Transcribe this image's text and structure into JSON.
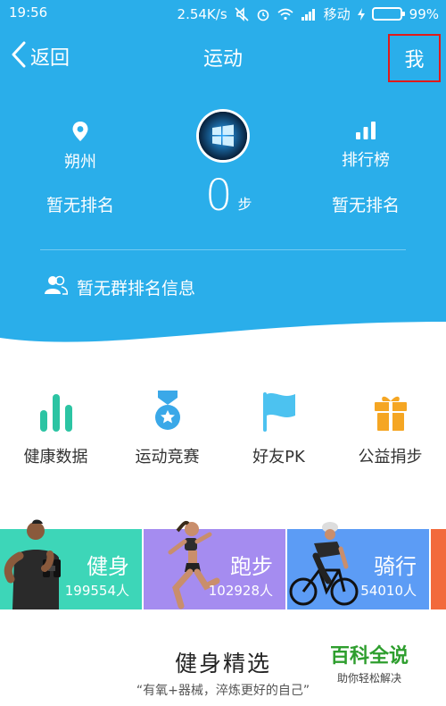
{
  "status_bar": {
    "time": "19:56",
    "network_speed": "2.54K/s",
    "carrier": "移动",
    "battery": "99%",
    "battery_level": 0.99
  },
  "nav": {
    "back_label": "返回",
    "title": "运动",
    "me_label": "我"
  },
  "profile": {
    "location": "朔州",
    "rank_board_label": "排行榜",
    "rank_left": "暂无排名",
    "rank_right": "暂无排名",
    "steps": "0",
    "steps_unit": "步",
    "group_info": "暂无群排名信息"
  },
  "features": [
    {
      "label": "健康数据",
      "icon": "bar-chart-icon",
      "color": "#2cc4a3"
    },
    {
      "label": "运动竞赛",
      "icon": "medal-icon",
      "color": "#3aa8e8"
    },
    {
      "label": "好友PK",
      "icon": "flag-icon",
      "color": "#4cc2f0"
    },
    {
      "label": "公益捐步",
      "icon": "gift-icon",
      "color": "#f5a623"
    }
  ],
  "categories": [
    {
      "title": "健身",
      "count": "199554人",
      "color": "#3dd6b8"
    },
    {
      "title": "跑步",
      "count": "102928人",
      "color": "#a58cf0"
    },
    {
      "title": "骑行",
      "count": "54010人",
      "color": "#5c9cf5"
    }
  ],
  "section": {
    "title": "健身精选",
    "subtitle": "“有氧+器械，淬炼更好的自己”"
  },
  "watermark": {
    "main": "百科全说",
    "sub": "助你轻松解决"
  }
}
